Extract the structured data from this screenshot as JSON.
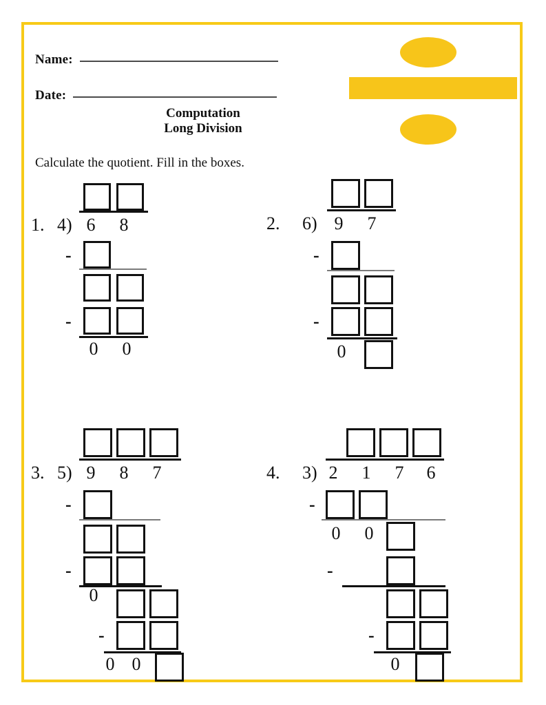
{
  "page": {
    "border_color": "#F7CA18",
    "background": "#ffffff"
  },
  "header": {
    "name_label": "Name:",
    "date_label": "Date:",
    "title_line1": "Computation",
    "title_line2": "Long Division",
    "divide_icon": "divide-symbol",
    "icon_fill_color": "#F7C51A",
    "icon_shadow_color": "#C99B10"
  },
  "instructions": {
    "text": "Calculate the quotient. Fill in the boxes."
  },
  "problems": [
    {
      "number": "1.",
      "divisor": "4)",
      "dividend_digits": [
        "6",
        "8"
      ],
      "quotient_boxes": 2,
      "minus_signs": [
        "-",
        "-"
      ],
      "work_zeros": [
        "0",
        "0"
      ],
      "remainder_boxes": 0
    },
    {
      "number": "2.",
      "divisor": "6)",
      "dividend_digits": [
        "9",
        "7"
      ],
      "quotient_boxes": 2,
      "minus_signs": [
        "-",
        "-"
      ],
      "work_zeros": [
        "0"
      ],
      "remainder_boxes": 1
    },
    {
      "number": "3.",
      "divisor": "5)",
      "dividend_digits": [
        "9",
        "8",
        "7"
      ],
      "quotient_boxes": 3,
      "minus_signs": [
        "-",
        "-",
        "-"
      ],
      "work_zeros": [
        "0",
        "0",
        "0"
      ],
      "remainder_boxes": 1
    },
    {
      "number": "4.",
      "divisor": "3)",
      "dividend_digits": [
        "2",
        "1",
        "7",
        "6"
      ],
      "quotient_boxes": 3,
      "minus_signs": [
        "-",
        "-",
        "-"
      ],
      "work_zeros": [
        "0",
        "0",
        "0"
      ],
      "remainder_boxes": 1
    }
  ]
}
